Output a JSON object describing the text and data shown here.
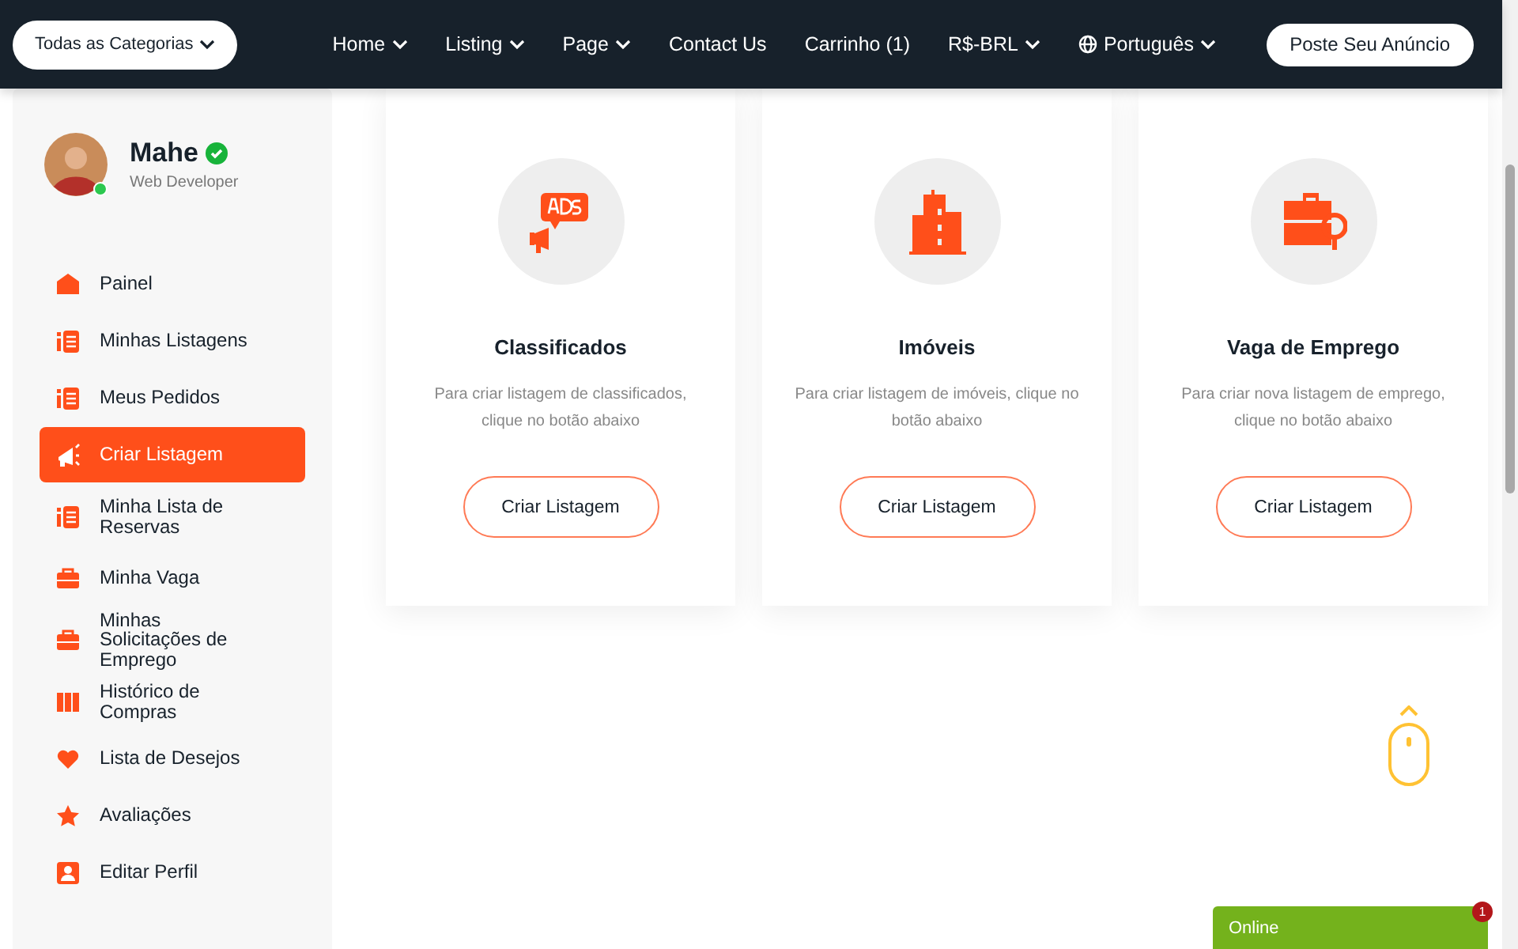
{
  "header": {
    "category_button": "Todas as Categorias",
    "nav": [
      {
        "label": "Home",
        "dropdown": true
      },
      {
        "label": "Listing",
        "dropdown": true
      },
      {
        "label": "Page",
        "dropdown": true
      },
      {
        "label": "Contact Us",
        "dropdown": false
      },
      {
        "label": "Carrinho (1)",
        "dropdown": false
      },
      {
        "label": "R$-BRL",
        "dropdown": true
      }
    ],
    "language": "Português",
    "post_button": "Poste Seu Anúncio"
  },
  "profile": {
    "name": "Mahe",
    "verified": true,
    "role": "Web Developer",
    "online": true
  },
  "sidebar": {
    "items": [
      {
        "label": "Painel",
        "kind": "home",
        "selected": false
      },
      {
        "label": "Minhas Listagens",
        "kind": "list",
        "selected": false
      },
      {
        "label": "Meus Pedidos",
        "kind": "list",
        "selected": false
      },
      {
        "label": "Criar Listagem",
        "kind": "megaphone",
        "selected": true
      },
      {
        "label": "Minha Lista de Reservas",
        "kind": "list",
        "selected": false
      },
      {
        "label": "Minha Vaga",
        "kind": "briefcase",
        "selected": false
      },
      {
        "label": "Minhas Solicitações de Emprego",
        "kind": "briefcase",
        "selected": false
      },
      {
        "label": "Histórico de Compras",
        "kind": "receipt",
        "selected": false
      },
      {
        "label": "Lista de Desejos",
        "kind": "heart",
        "selected": false
      },
      {
        "label": "Avaliações",
        "kind": "star",
        "selected": false
      },
      {
        "label": "Editar Perfil",
        "kind": "user",
        "selected": false
      }
    ]
  },
  "cards": [
    {
      "kind": "ads",
      "title": "Classificados",
      "description": "Para criar listagem de classificados, clique no botão abaixo",
      "button": "Criar Listagem"
    },
    {
      "kind": "building",
      "title": "Imóveis",
      "description": "Para criar listagem de imóveis, clique no botão abaixo",
      "button": "Criar Listagem"
    },
    {
      "kind": "job",
      "title": "Vaga de Emprego",
      "description": "Para criar nova listagem de emprego, clique no botão abaixo",
      "button": "Criar Listagem"
    }
  ],
  "chat": {
    "label": "Online",
    "badge": "1"
  }
}
